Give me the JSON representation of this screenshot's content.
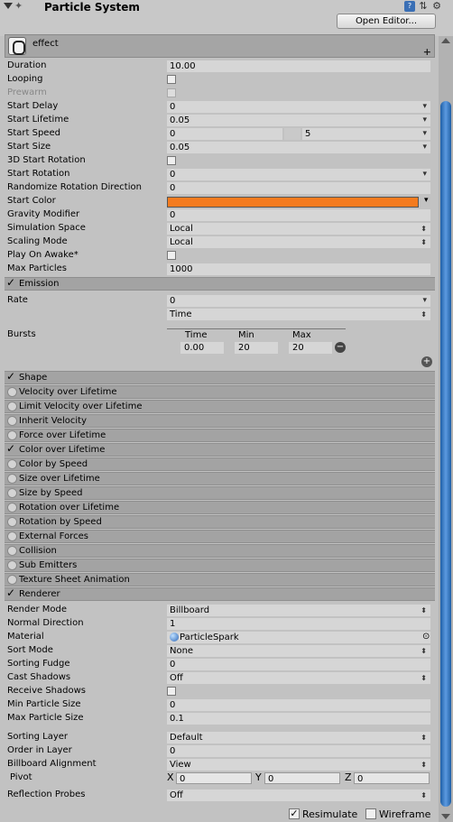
{
  "header": {
    "title": "Particle System",
    "open_editor": "Open Editor...",
    "logo": "particle-icon",
    "icons": [
      "book-icon",
      "preset-icon",
      "gear-icon"
    ]
  },
  "effect": {
    "name": "effect"
  },
  "main": [
    {
      "label": "Duration",
      "value": "10.00",
      "type": "plain"
    },
    {
      "label": "Looping",
      "type": "check",
      "checked": false
    },
    {
      "label": "Prewarm",
      "type": "check",
      "checked": false,
      "disabled": true
    },
    {
      "label": "Start Delay",
      "value": "0",
      "type": "drop"
    },
    {
      "label": "Start Lifetime",
      "value": "0.05",
      "type": "drop"
    },
    {
      "label": "Start Speed",
      "value": "0",
      "value2": "5",
      "type": "range"
    },
    {
      "label": "Start Size",
      "value": "0.05",
      "type": "drop"
    },
    {
      "label": "3D Start Rotation",
      "type": "check",
      "checked": false
    },
    {
      "label": "Start Rotation",
      "value": "0",
      "type": "drop"
    },
    {
      "label": "Randomize Rotation Direction",
      "value": "0",
      "type": "plain"
    },
    {
      "label": "Start Color",
      "type": "color",
      "color": "#f47b1f"
    },
    {
      "label": "Gravity Modifier",
      "value": "0",
      "type": "plain"
    },
    {
      "label": "Simulation Space",
      "value": "Local",
      "type": "spin"
    },
    {
      "label": "Scaling Mode",
      "value": "Local",
      "type": "spin"
    },
    {
      "label": "Play On Awake*",
      "type": "check",
      "checked": false
    },
    {
      "label": "Max Particles",
      "value": "1000",
      "type": "plain"
    }
  ],
  "emission": {
    "title": "Emission",
    "enabled": true,
    "rate_label": "Rate",
    "rate_value": "0",
    "rate_mode": "Time",
    "bursts_label": "Bursts",
    "col_time": "Time",
    "col_min": "Min",
    "col_max": "Max",
    "burst_time": "0.00",
    "burst_min": "20",
    "burst_max": "20"
  },
  "modules": [
    {
      "label": "Shape",
      "enabled": true
    },
    {
      "label": "Velocity over Lifetime",
      "enabled": false
    },
    {
      "label": "Limit Velocity over Lifetime",
      "enabled": false
    },
    {
      "label": "Inherit Velocity",
      "enabled": false
    },
    {
      "label": "Force over Lifetime",
      "enabled": false
    },
    {
      "label": "Color over Lifetime",
      "enabled": true
    },
    {
      "label": "Color by Speed",
      "enabled": false
    },
    {
      "label": "Size over Lifetime",
      "enabled": false
    },
    {
      "label": "Size by Speed",
      "enabled": false
    },
    {
      "label": "Rotation over Lifetime",
      "enabled": false
    },
    {
      "label": "Rotation by Speed",
      "enabled": false
    },
    {
      "label": "External Forces",
      "enabled": false
    },
    {
      "label": "Collision",
      "enabled": false
    },
    {
      "label": "Sub Emitters",
      "enabled": false
    },
    {
      "label": "Texture Sheet Animation",
      "enabled": false
    },
    {
      "label": "Renderer",
      "enabled": true
    }
  ],
  "renderer": [
    {
      "label": "Render Mode",
      "value": "Billboard",
      "type": "spin"
    },
    {
      "label": "Normal Direction",
      "value": "1",
      "type": "plain"
    },
    {
      "label": "Material",
      "value": "ParticleSpark",
      "type": "material"
    },
    {
      "label": "Sort Mode",
      "value": "None",
      "type": "spin"
    },
    {
      "label": "Sorting Fudge",
      "value": "0",
      "type": "plain"
    },
    {
      "label": "Cast Shadows",
      "value": "Off",
      "type": "spin"
    },
    {
      "label": "Receive Shadows",
      "type": "check",
      "checked": false
    },
    {
      "label": "Min Particle Size",
      "value": "0",
      "type": "plain"
    },
    {
      "label": "Max Particle Size",
      "value": "0.1",
      "type": "plain"
    }
  ],
  "renderer2": [
    {
      "label": "Sorting Layer",
      "value": "Default",
      "type": "spin"
    },
    {
      "label": "Order in Layer",
      "value": "0",
      "type": "plain"
    },
    {
      "label": "Billboard Alignment",
      "value": "View",
      "type": "spin"
    }
  ],
  "pivot": {
    "label": "Pivot",
    "x_label": "X",
    "x": "0",
    "y_label": "Y",
    "y": "0",
    "z_label": "Z",
    "z": "0"
  },
  "reflection": {
    "label": "Reflection Probes",
    "value": "Off"
  },
  "bottom": {
    "resimulate": "Resimulate",
    "resimulate_checked": true,
    "wireframe": "Wireframe",
    "wireframe_checked": false
  }
}
